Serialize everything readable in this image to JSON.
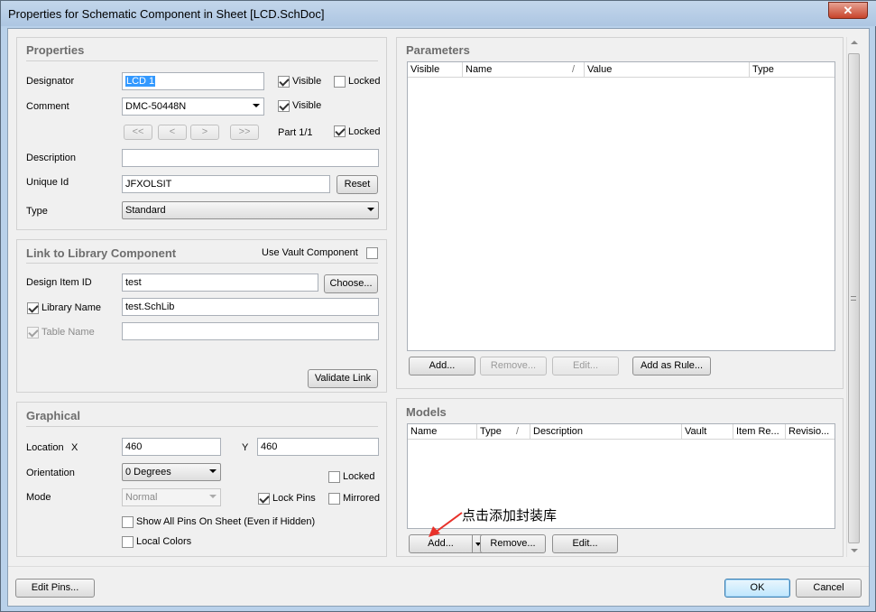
{
  "window": {
    "title": "Properties for Schematic Component in Sheet [LCD.SchDoc]",
    "close_glyph": "✕"
  },
  "properties": {
    "title": "Properties",
    "designator_label": "Designator",
    "designator_value": "LCD 1",
    "visible_label": "Visible",
    "locked_label": "Locked",
    "comment_label": "Comment",
    "comment_value": "DMC-50448N",
    "nav_first": "<<",
    "nav_prev": "<",
    "nav_next": ">",
    "nav_last": ">>",
    "part_label": "Part 1/1",
    "description_label": "Description",
    "description_value": "",
    "unique_id_label": "Unique Id",
    "unique_id_value": "JFXOLSIT",
    "reset_label": "Reset",
    "type_label": "Type",
    "type_value": "Standard"
  },
  "library": {
    "title": "Link to Library Component",
    "use_vault_label": "Use Vault Component",
    "design_item_label": "Design Item ID",
    "design_item_value": "test",
    "choose_label": "Choose...",
    "library_name_label": "Library Name",
    "library_name_value": "test.SchLib",
    "table_name_label": "Table Name",
    "table_name_value": "",
    "validate_label": "Validate Link"
  },
  "graphical": {
    "title": "Graphical",
    "location_label": "Location",
    "x_label": "X",
    "x_value": "460",
    "y_label": "Y",
    "y_value": "460",
    "orientation_label": "Orientation",
    "orientation_value": "0 Degrees",
    "locked_label": "Locked",
    "mode_label": "Mode",
    "mode_value": "Normal",
    "lock_pins_label": "Lock Pins",
    "mirrored_label": "Mirrored",
    "show_all_pins_label": "Show All Pins On Sheet (Even if Hidden)",
    "local_colors_label": "Local Colors"
  },
  "parameters": {
    "title": "Parameters",
    "columns": [
      "Visible",
      "Name",
      "Value",
      "Type"
    ],
    "sort_glyph": "/",
    "add_label": "Add...",
    "remove_label": "Remove...",
    "edit_label": "Edit...",
    "add_rule_label": "Add as Rule..."
  },
  "models": {
    "title": "Models",
    "columns": [
      "Name",
      "Type",
      "Description",
      "Vault",
      "Item Re...",
      "Revisio..."
    ],
    "sort_glyph": "/",
    "add_label": "Add...",
    "remove_label": "Remove...",
    "edit_label": "Edit...",
    "annotation": "点击添加封装库",
    "annotation_color": "#e8312a"
  },
  "footer": {
    "edit_pins_label": "Edit Pins...",
    "ok_label": "OK",
    "cancel_label": "Cancel"
  }
}
